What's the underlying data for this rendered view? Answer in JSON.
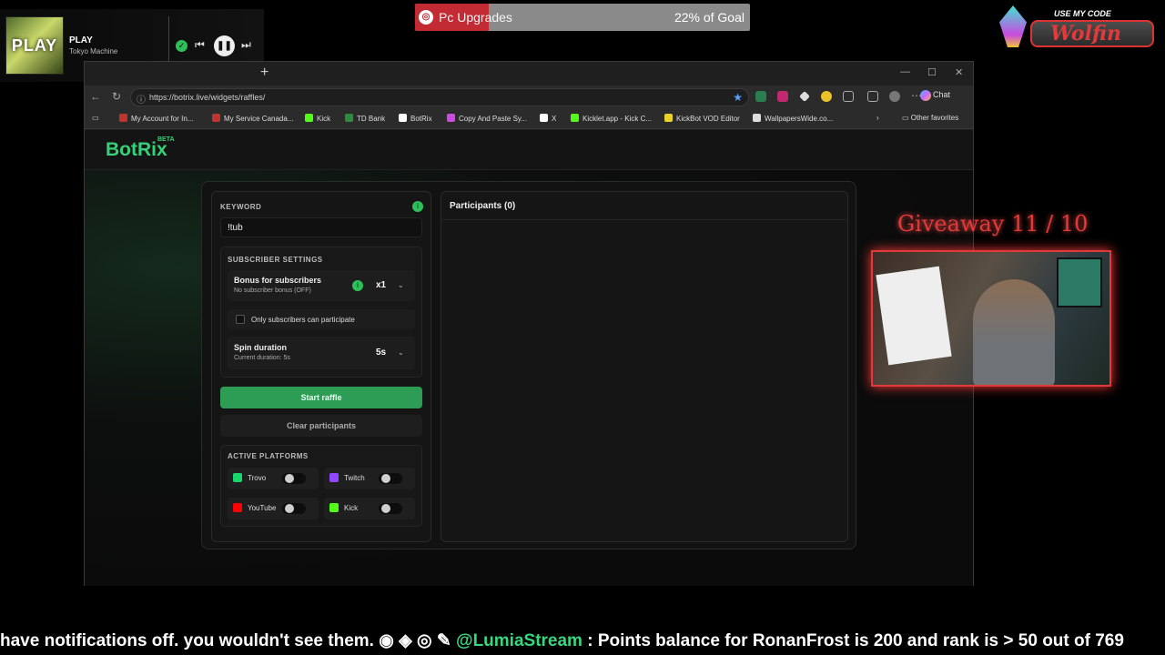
{
  "now_playing": {
    "action": "PLAY",
    "artist": "Tokyo Machine",
    "art_text": "PLAY"
  },
  "goal": {
    "label": "Pc Upgrades",
    "percent_text": "22% of Goal",
    "percent": 22
  },
  "code": {
    "prefix": "USE MY CODE",
    "name": "Wolfin"
  },
  "giveaway": {
    "text": "Giveaway 11 / 10"
  },
  "ticker": {
    "part1": "have notifications off. you wouldn't see them.",
    "handle": "@LumiaStream",
    "part2": ": Points balance for RonanFrost is 200 and rank is > 50 out of 769"
  },
  "browser": {
    "url": "https://botrix.live/widgets/raffles/",
    "chat_label": "Chat",
    "bookmarks": [
      {
        "label": "My Account for In...",
        "color": "#c0342f"
      },
      {
        "label": "My Service Canada...",
        "color": "#c0342f"
      },
      {
        "label": "Kick",
        "color": "#53fc18"
      },
      {
        "label": "TD Bank",
        "color": "#2e8b3c"
      },
      {
        "label": "BotRix",
        "color": "#ffffff"
      },
      {
        "label": "Copy And Paste Sy...",
        "color": "#c94be0"
      },
      {
        "label": "X",
        "color": "#ffffff"
      },
      {
        "label": "Kicklet.app - Kick C...",
        "color": "#53fc18"
      },
      {
        "label": "KickBot VOD Editor",
        "color": "#e9d12a"
      },
      {
        "label": "WallpapersWide.co...",
        "color": "#dddddd"
      }
    ],
    "other_favorites": "Other favorites"
  },
  "app": {
    "brand": "BotRix",
    "beta": "BETA",
    "keyword_label": "KEYWORD",
    "keyword_value": "!tub",
    "subscriber_settings_label": "SUBSCRIBER SETTINGS",
    "bonus_title": "Bonus for subscribers",
    "bonus_sub": "No subscriber bonus (OFF)",
    "bonus_value": "x1",
    "only_subs_label": "Only subscribers can participate",
    "spin_title": "Spin duration",
    "spin_sub": "Current duration: 5s",
    "spin_value": "5s",
    "start_button": "Start raffle",
    "clear_button": "Clear participants",
    "active_platforms_label": "ACTIVE PLATFORMS",
    "platforms": [
      {
        "name": "Trovo",
        "color": "#19d66b",
        "enabled": false
      },
      {
        "name": "Twitch",
        "color": "#9146ff",
        "enabled": false
      },
      {
        "name": "YouTube",
        "color": "#ff0000",
        "enabled": false
      },
      {
        "name": "Kick",
        "color": "#53fc18",
        "enabled": false
      }
    ],
    "participants_title": "Participants (0)"
  },
  "colors": {
    "accent": "#36d07a",
    "button": "#2d9c55",
    "alert": "#e23a3a"
  }
}
